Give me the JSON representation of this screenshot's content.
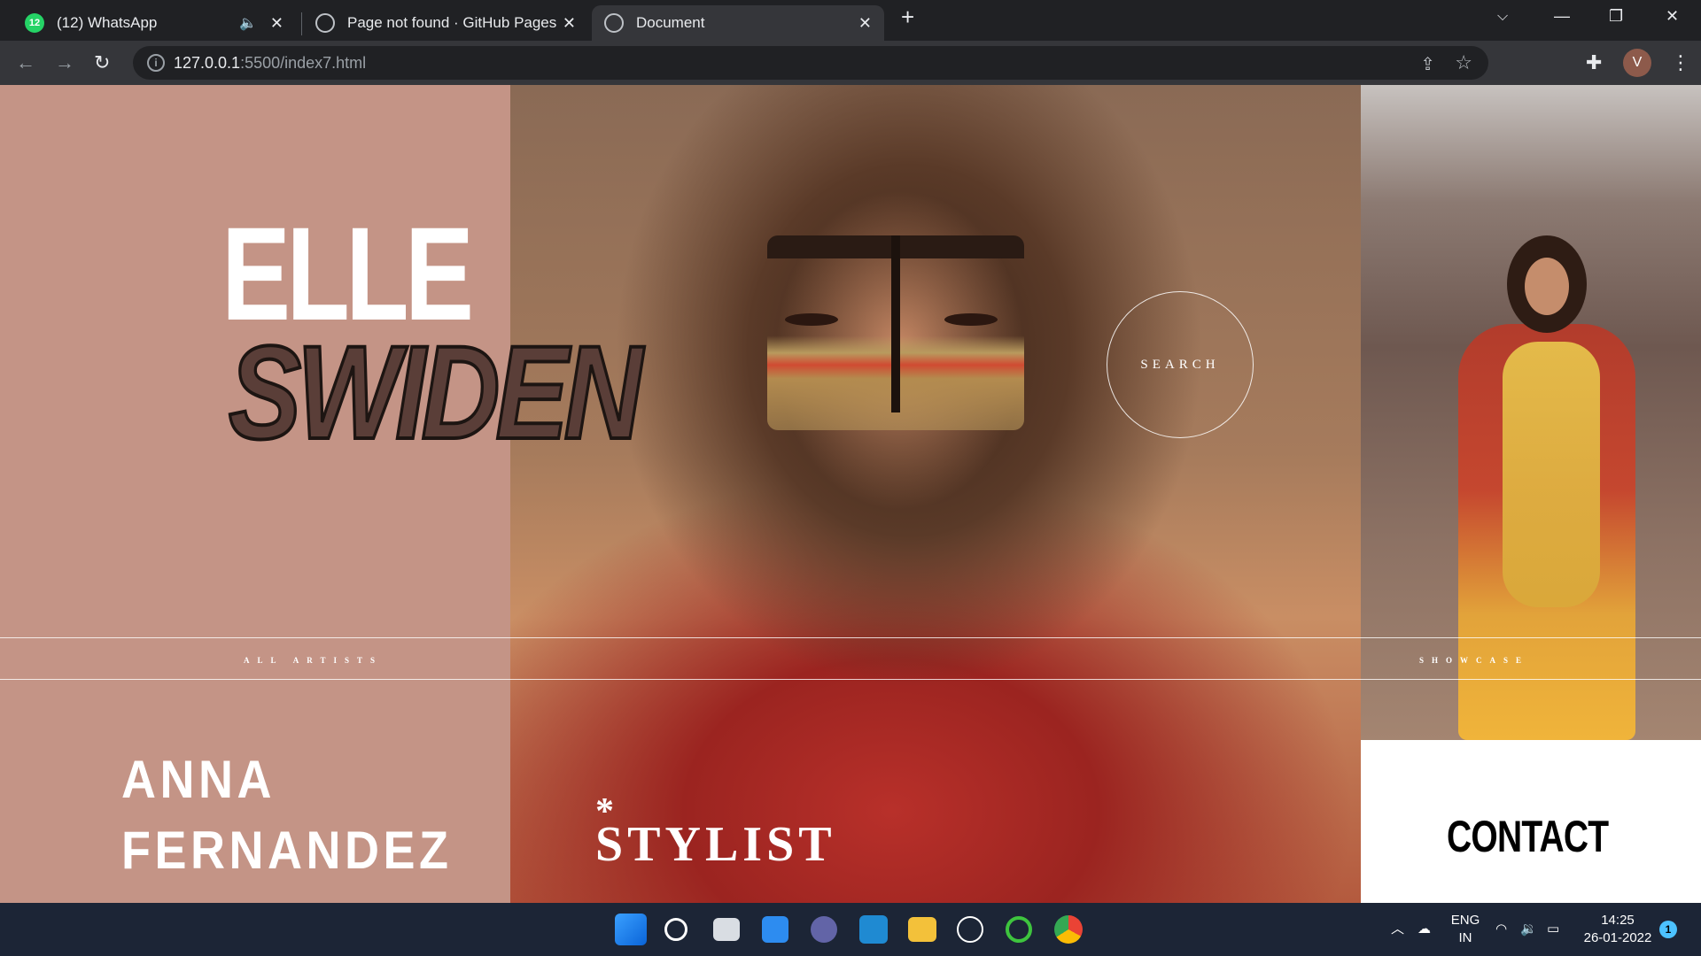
{
  "browser": {
    "tabs": [
      {
        "label": "(12) WhatsApp",
        "badge": "12",
        "icon": "whatsapp-icon"
      },
      {
        "label": "Page not found · GitHub Pages",
        "icon": "globe-icon"
      },
      {
        "label": "Document",
        "icon": "globe-icon",
        "active": true
      }
    ],
    "url_host": "127.0.0.1",
    "url_path": ":5500/index7.html",
    "profile_initial": "V"
  },
  "page": {
    "title_line1": "ELLE",
    "title_line2": "SWIDEN",
    "search_label": "SEARCH",
    "nav_left": "ALL ARTISTS",
    "nav_right": "SHOWCASE",
    "artist_first": "ANNA",
    "artist_last": "FERNANDEZ",
    "asterisk": "*",
    "role": "STYLIST",
    "contact": "CONTACT",
    "colors": {
      "panel": "#c49486",
      "swiden": "#5a3e38",
      "contact_bg": "#ffffff"
    }
  },
  "taskbar": {
    "language_line1": "ENG",
    "language_line2": "IN",
    "time": "14:25",
    "date": "26-01-2022",
    "notification_count": "1"
  }
}
